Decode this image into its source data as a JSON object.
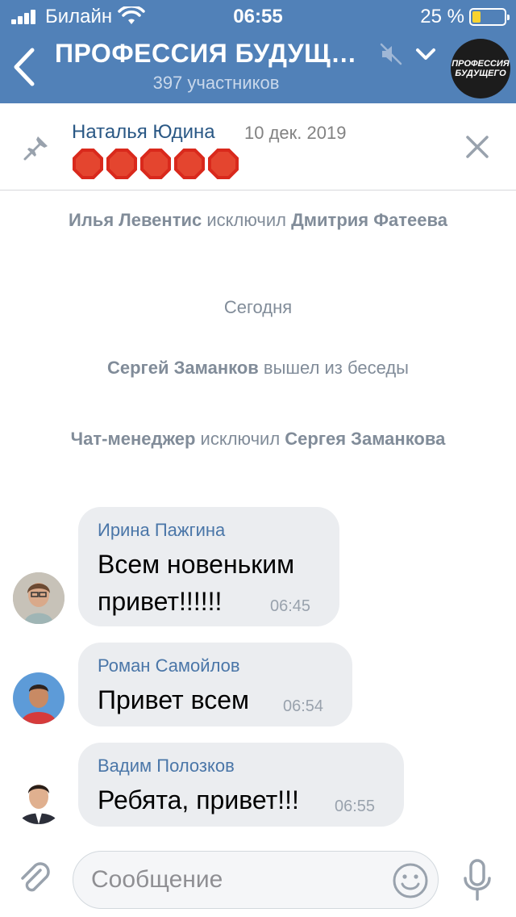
{
  "status_bar": {
    "carrier": "Билайн",
    "time": "06:55",
    "battery_percent": "25 %",
    "battery_level": 0.25,
    "battery_color": "#f7d330"
  },
  "header": {
    "title": "ПРОФЕССИЯ БУДУЩЕ...",
    "subtitle": "397 участников",
    "avatar_line1": "ПРОФЕССИЯ",
    "avatar_line2": "БУДУЩЕГО",
    "icons": [
      "back-icon",
      "mute-icon",
      "chevron-down-icon"
    ],
    "background_color": "#5181b8"
  },
  "pinned": {
    "author": "Наталья Юдина",
    "date": "10 дек. 2019",
    "emoji_name": "stop-sign",
    "emoji_count": 5
  },
  "service_messages": [
    {
      "actor": "Илья Левентис",
      "action": " исключил ",
      "target": "Дмитрия Фатеева"
    },
    {
      "text": "Сегодня"
    },
    {
      "actor": "Сергей Заманков",
      "action": " вышел из беседы"
    },
    {
      "actor": "Чат-менеджер",
      "action": " исключил ",
      "target": "Сергея Заманкова"
    }
  ],
  "messages": [
    {
      "author": "Ирина Пажгина",
      "text_line1": "Всем новеньким",
      "text_line2": "привет!!!!!!",
      "time": "06:45"
    },
    {
      "author": "Роман Самойлов",
      "text_line1": "Привет всем",
      "time": "06:54"
    },
    {
      "author": "Вадим Полозков",
      "text_line1": "Ребята, привет!!!",
      "time": "06:55"
    }
  ],
  "composer": {
    "placeholder": "Сообщение",
    "icons": [
      "attach-icon",
      "emoji-icon",
      "mic-icon"
    ]
  }
}
